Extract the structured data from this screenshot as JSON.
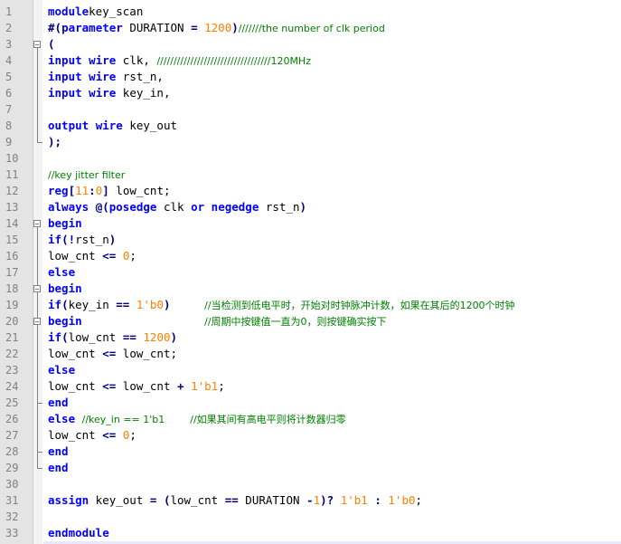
{
  "lines": [
    {
      "n": "1",
      "t": [
        [
          "kw",
          "module"
        ],
        [
          "",
          "key_scan"
        ]
      ]
    },
    {
      "n": "2",
      "t": [
        [
          "op",
          "#("
        ],
        [
          "kw",
          "parameter"
        ],
        [
          "",
          " DURATION "
        ],
        [
          "op",
          "="
        ],
        [
          "",
          " "
        ],
        [
          "num",
          "1200"
        ],
        [
          "op",
          ")"
        ],
        [
          "cm",
          "///////the number of clk period"
        ]
      ]
    },
    {
      "n": "3",
      "t": [
        [
          "op",
          "("
        ]
      ]
    },
    {
      "n": "4",
      "t": [
        [
          "kw",
          "input"
        ],
        [
          "",
          " "
        ],
        [
          "kw",
          "wire"
        ],
        [
          "",
          " clk, "
        ],
        [
          "cm",
          "//////////////////////////////////120MHz"
        ]
      ]
    },
    {
      "n": "5",
      "t": [
        [
          "kw",
          "input"
        ],
        [
          "",
          " "
        ],
        [
          "kw",
          "wire"
        ],
        [
          "",
          " rst_n,"
        ]
      ]
    },
    {
      "n": "6",
      "t": [
        [
          "kw",
          "input"
        ],
        [
          "",
          " "
        ],
        [
          "kw",
          "wire"
        ],
        [
          "",
          " key_in,"
        ]
      ]
    },
    {
      "n": "7",
      "t": []
    },
    {
      "n": "8",
      "t": [
        [
          "kw",
          "output"
        ],
        [
          "",
          " "
        ],
        [
          "kw",
          "wire"
        ],
        [
          "",
          " key_out"
        ]
      ]
    },
    {
      "n": "9",
      "t": [
        [
          "op",
          ");"
        ]
      ]
    },
    {
      "n": "10",
      "t": []
    },
    {
      "n": "11",
      "t": [
        [
          "cm",
          "//key jitter filter"
        ]
      ]
    },
    {
      "n": "12",
      "t": [
        [
          "kw",
          "reg"
        ],
        [
          "op",
          "["
        ],
        [
          "num",
          "11"
        ],
        [
          "op",
          ":"
        ],
        [
          "num",
          "0"
        ],
        [
          "op",
          "]"
        ],
        [
          "",
          " low_cnt;"
        ]
      ]
    },
    {
      "n": "13",
      "t": [
        [
          "kw",
          "always"
        ],
        [
          "",
          " "
        ],
        [
          "op",
          "@("
        ],
        [
          "kw",
          "posedge"
        ],
        [
          "",
          " clk "
        ],
        [
          "kw",
          "or"
        ],
        [
          "",
          " "
        ],
        [
          "kw",
          "negedge"
        ],
        [
          "",
          " rst_n"
        ],
        [
          "op",
          ")"
        ]
      ]
    },
    {
      "n": "14",
      "t": [
        [
          "kw",
          "begin"
        ]
      ]
    },
    {
      "n": "15",
      "t": [
        [
          "kw",
          "if"
        ],
        [
          "op",
          "(!"
        ],
        [
          "",
          "rst_n"
        ],
        [
          "op",
          ")"
        ]
      ]
    },
    {
      "n": "16",
      "t": [
        [
          "",
          "low_cnt "
        ],
        [
          "op",
          "<="
        ],
        [
          "",
          " "
        ],
        [
          "num",
          "0"
        ],
        [
          "",
          ";"
        ]
      ]
    },
    {
      "n": "17",
      "t": [
        [
          "kw",
          "else"
        ]
      ]
    },
    {
      "n": "18",
      "t": [
        [
          "kw",
          "begin"
        ]
      ]
    },
    {
      "n": "19",
      "t": [
        [
          "kw",
          "if"
        ],
        [
          "op",
          "("
        ],
        [
          "",
          "key_in "
        ],
        [
          "op",
          "=="
        ],
        [
          "",
          " "
        ],
        [
          "num",
          "1'b0"
        ],
        [
          "op",
          ")"
        ],
        [
          "",
          "     "
        ],
        [
          "cm",
          "//当检测到低电平时，开始对时钟脉冲计数，如果在其后的1200个时钟"
        ]
      ]
    },
    {
      "n": "20",
      "t": [
        [
          "kw",
          "begin"
        ],
        [
          "",
          "                  "
        ],
        [
          "cm",
          "//周期中按键值一直为0，则按键确实按下"
        ]
      ]
    },
    {
      "n": "21",
      "t": [
        [
          "kw",
          "if"
        ],
        [
          "op",
          "("
        ],
        [
          "",
          "low_cnt "
        ],
        [
          "op",
          "=="
        ],
        [
          "",
          " "
        ],
        [
          "num",
          "1200"
        ],
        [
          "op",
          ")"
        ]
      ]
    },
    {
      "n": "22",
      "t": [
        [
          "",
          "low_cnt "
        ],
        [
          "op",
          "<="
        ],
        [
          "",
          " low_cnt;"
        ]
      ]
    },
    {
      "n": "23",
      "t": [
        [
          "kw",
          "else"
        ]
      ]
    },
    {
      "n": "24",
      "t": [
        [
          "",
          "low_cnt "
        ],
        [
          "op",
          "<="
        ],
        [
          "",
          " low_cnt "
        ],
        [
          "op",
          "+"
        ],
        [
          "",
          " "
        ],
        [
          "num",
          "1'b1"
        ],
        [
          "",
          ";"
        ]
      ]
    },
    {
      "n": "25",
      "t": [
        [
          "kw",
          "end"
        ]
      ]
    },
    {
      "n": "26",
      "t": [
        [
          "kw",
          "else"
        ],
        [
          "",
          " "
        ],
        [
          "cm",
          "//key_in == 1'b1        //如果其间有高电平则将计数器归零"
        ]
      ]
    },
    {
      "n": "27",
      "t": [
        [
          "",
          "low_cnt "
        ],
        [
          "op",
          "<="
        ],
        [
          "",
          " "
        ],
        [
          "num",
          "0"
        ],
        [
          "",
          ";"
        ]
      ]
    },
    {
      "n": "28",
      "t": [
        [
          "kw",
          "end"
        ]
      ]
    },
    {
      "n": "29",
      "t": [
        [
          "kw",
          "end"
        ]
      ]
    },
    {
      "n": "30",
      "t": []
    },
    {
      "n": "31",
      "t": [
        [
          "kw",
          "assign"
        ],
        [
          "",
          " key_out "
        ],
        [
          "op",
          "="
        ],
        [
          "",
          " "
        ],
        [
          "op",
          "("
        ],
        [
          "",
          "low_cnt "
        ],
        [
          "op",
          "=="
        ],
        [
          "",
          " DURATION "
        ],
        [
          "op",
          "-"
        ],
        [
          "num",
          "1"
        ],
        [
          "op",
          ")?"
        ],
        [
          "",
          " "
        ],
        [
          "num",
          "1'b1"
        ],
        [
          "",
          " "
        ],
        [
          "op",
          ":"
        ],
        [
          "",
          " "
        ],
        [
          "num",
          "1'b0"
        ],
        [
          "",
          ";"
        ]
      ]
    },
    {
      "n": "32",
      "t": []
    },
    {
      "n": "33",
      "t": [
        [
          "kw",
          "endmodule"
        ]
      ]
    }
  ]
}
